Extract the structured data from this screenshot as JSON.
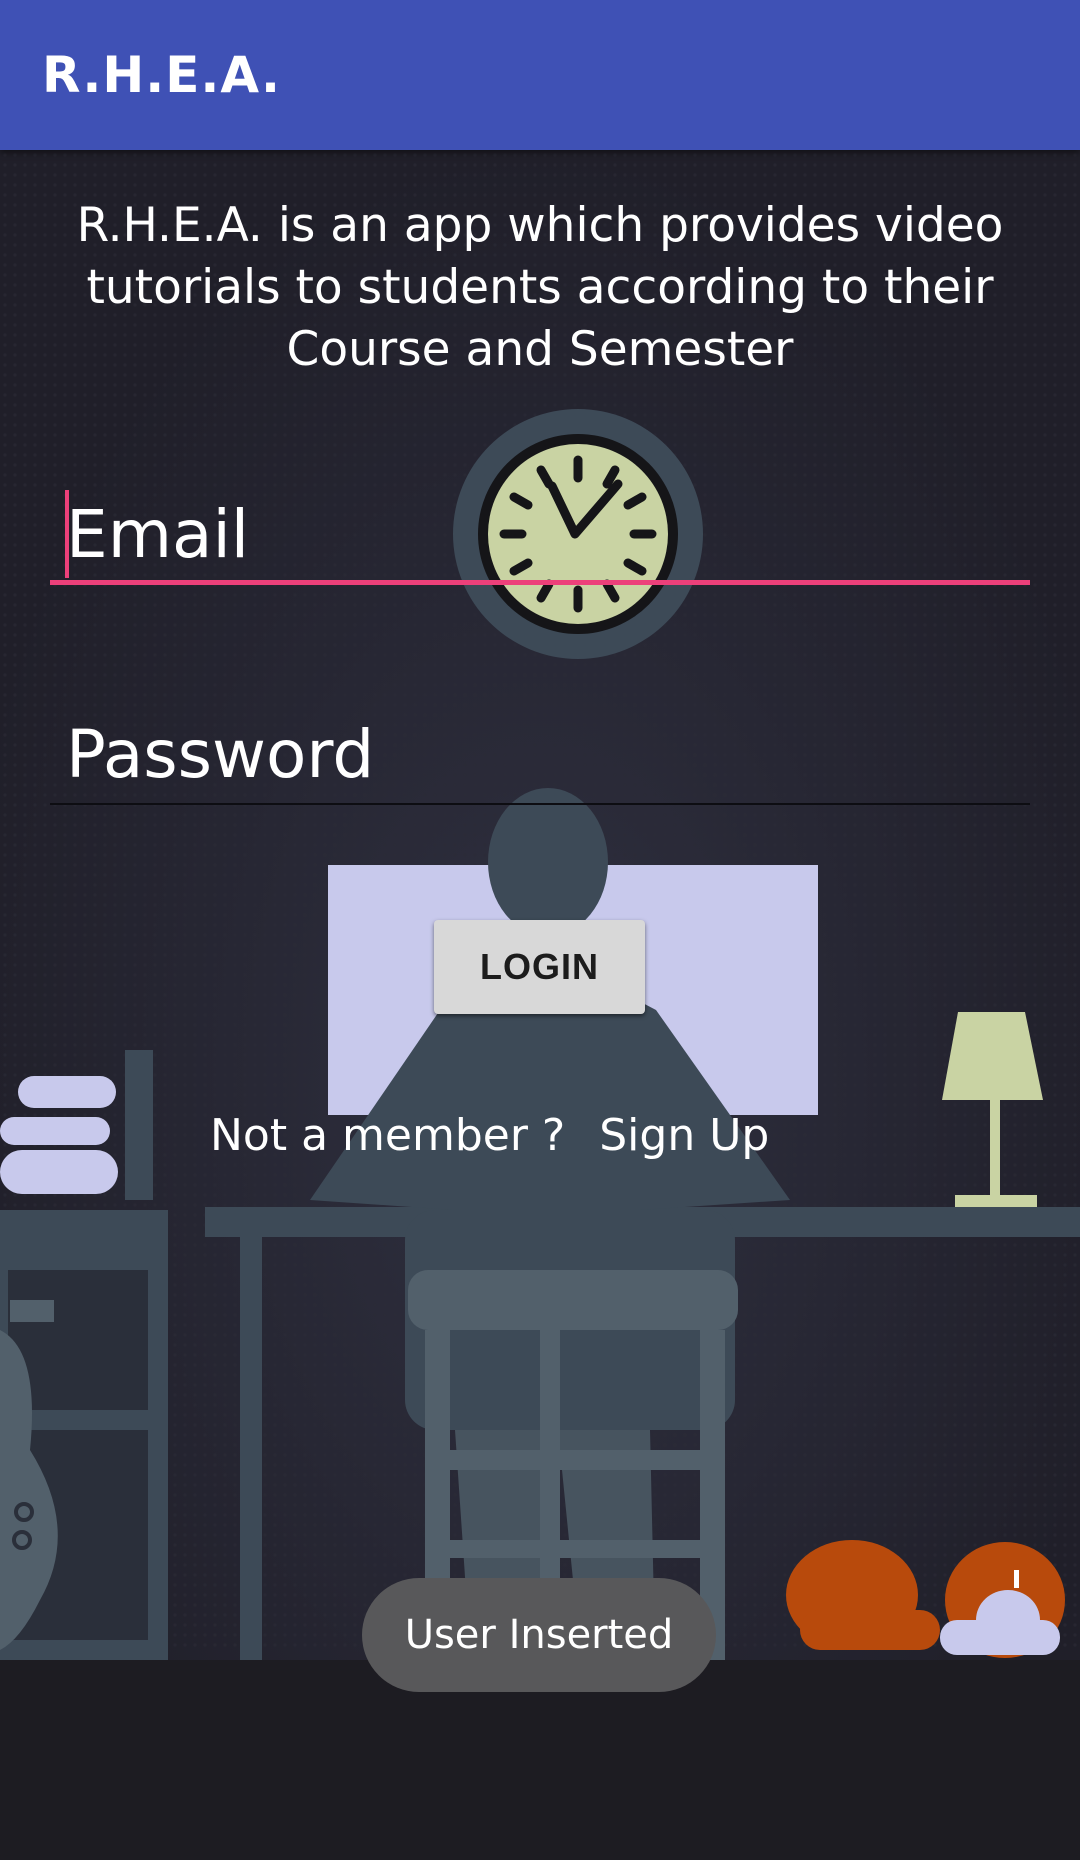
{
  "appbar": {
    "title": "R.H.E.A."
  },
  "description": "R.H.E.A. is an app which provides video tutorials to students according to their Course and Semester",
  "form": {
    "email_placeholder": "Email",
    "password_placeholder": "Password",
    "login_label": "LOGIN"
  },
  "signup_prompt": {
    "text": "Not a member ?",
    "link": "Sign Up"
  },
  "toast": {
    "message": "User Inserted"
  },
  "colors": {
    "appbar": "#3f51b5",
    "accent": "#ec407a",
    "background": "#201f29",
    "illustration_shade": "#3d4a57",
    "clock_face": "#c9d3a3",
    "monitor": "#c8c9ec"
  },
  "icons": [
    "clock-illustration",
    "lamp-illustration",
    "sleeping-dog-illustration",
    "guitar-illustration"
  ]
}
